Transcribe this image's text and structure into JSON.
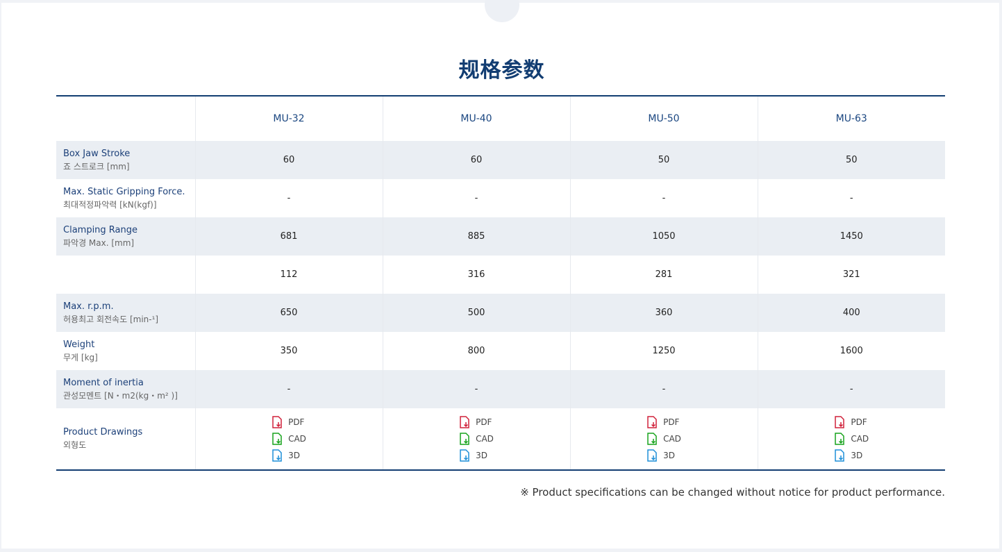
{
  "page": {
    "title": "规格参数"
  },
  "models": [
    "MU-32",
    "MU-40",
    "MU-50",
    "MU-63"
  ],
  "rows": [
    {
      "en": "Box Jaw Stroke",
      "ko": "죠 스트로크 [mm]",
      "values": [
        "60",
        "60",
        "50",
        "50"
      ]
    },
    {
      "en": "Max. Static Gripping Force.",
      "ko": "최대적정파악력 [kN(kgf)]",
      "values": [
        "-",
        "-",
        "-",
        "-"
      ]
    },
    {
      "en": "Clamping Range",
      "ko": "파악경 Max. [mm]",
      "values": [
        "681",
        "885",
        "1050",
        "1450"
      ]
    },
    {
      "en": "",
      "ko": "",
      "values": [
        "112",
        "316",
        "281",
        "321"
      ]
    },
    {
      "en": "Max. r.p.m.",
      "ko": "허용최고 회전속도 [min-¹]",
      "values": [
        "650",
        "500",
        "360",
        "400"
      ]
    },
    {
      "en": "Weight",
      "ko": "무게 [kg]",
      "values": [
        "350",
        "800",
        "1250",
        "1600"
      ]
    },
    {
      "en": "Moment of inertia",
      "ko": "관성모멘트 [N・m2(kg・m² )]",
      "values": [
        "-",
        "-",
        "-",
        "-"
      ]
    }
  ],
  "drawings": {
    "en": "Product Drawings",
    "ko": "외형도",
    "pdf_label": "PDF",
    "cad_label": "CAD",
    "threed_label": "3D",
    "pdf_color": "#d0213a",
    "cad_color": "#17a31c",
    "threed_color": "#1e8fd8"
  },
  "note": "※ Product specifications can be changed without notice for product performance.",
  "colors": {
    "accent": "#123d72",
    "row_shade": "#eaeef3"
  }
}
